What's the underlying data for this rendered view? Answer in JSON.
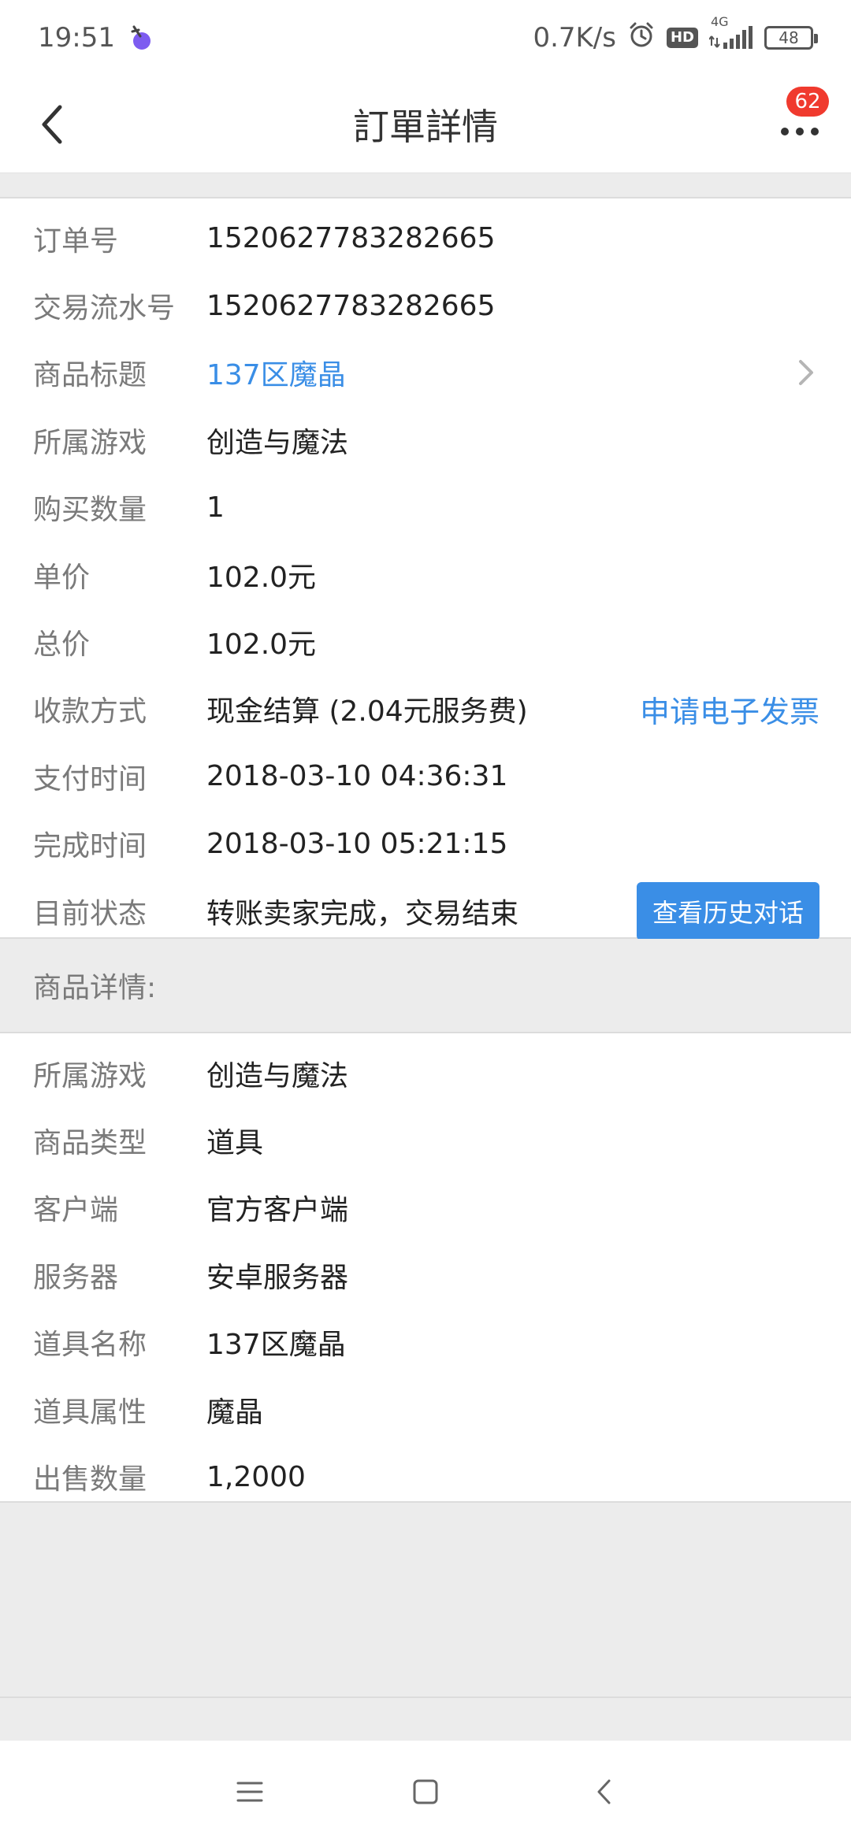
{
  "status_bar": {
    "time": "19:51",
    "network_speed": "0.7K/s",
    "hd_label": "HD",
    "network_type": "4G",
    "battery": "48"
  },
  "nav": {
    "title": "訂單詳情",
    "badge_count": "62"
  },
  "order": {
    "rows": [
      {
        "label": "订单号",
        "value": "1520627783282665"
      },
      {
        "label": "交易流水号",
        "value": "1520627783282665"
      },
      {
        "label": "商品标题",
        "value": "137区魔晶"
      },
      {
        "label": "所属游戏",
        "value": "创造与魔法"
      },
      {
        "label": "购买数量",
        "value": "1"
      },
      {
        "label": "单价",
        "value": "102.0元"
      },
      {
        "label": "总价",
        "value": "102.0元"
      },
      {
        "label": "收款方式",
        "value": "现金结算 (2.04元服务费)",
        "action": "申请电子发票"
      },
      {
        "label": "支付时间",
        "value": "2018-03-10 04:36:31"
      },
      {
        "label": "完成时间",
        "value": "2018-03-10 05:21:15"
      },
      {
        "label": "目前状态",
        "value": "转账卖家完成，交易结束",
        "action": "查看历史对话"
      }
    ]
  },
  "goods": {
    "header": "商品详情:",
    "rows": [
      {
        "label": "所属游戏",
        "value": "创造与魔法"
      },
      {
        "label": "商品类型",
        "value": "道具"
      },
      {
        "label": "客户端",
        "value": "官方客户端"
      },
      {
        "label": "服务器",
        "value": "安卓服务器"
      },
      {
        "label": "道具名称",
        "value": "137区魔晶"
      },
      {
        "label": "道具属性",
        "value": "魔晶"
      },
      {
        "label": "出售数量",
        "value": "1,2000"
      }
    ]
  },
  "colors": {
    "accent": "#3a8ee6",
    "badge": "#f03a2e",
    "background": "#ececec"
  },
  "icons": {
    "back": "chevron-left-icon",
    "more": "more-dots-icon",
    "title_arrow": "chevron-right-icon",
    "system_nav": [
      "menu-icon",
      "home-icon",
      "back-icon"
    ]
  }
}
